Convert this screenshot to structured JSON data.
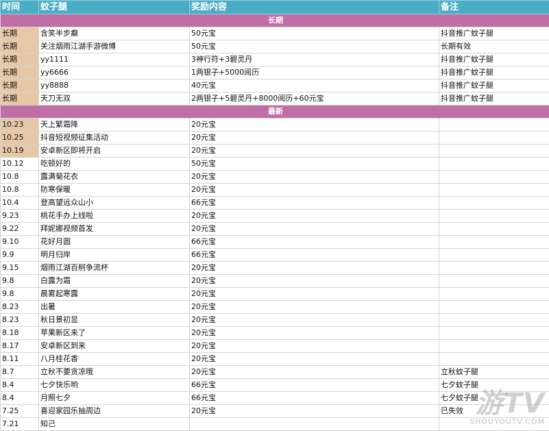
{
  "headers": [
    "时间",
    "蚊子腿",
    "奖励内容",
    "备注"
  ],
  "sections": [
    {
      "title": "长期",
      "rows": [
        {
          "time": "长期",
          "name": "含笑半步癫",
          "reward": "50元宝",
          "note": "抖音推广蚊子腿",
          "hl": true
        },
        {
          "time": "长期",
          "name": "关注烟雨江湖手游微博",
          "reward": "50元宝",
          "note": "长期有效",
          "hl": true
        },
        {
          "time": "长期",
          "name": "yy1111",
          "reward": "3神行符+3碧灵丹",
          "note": "抖音推广蚊子腿",
          "hl": true
        },
        {
          "time": "长期",
          "name": "yy6666",
          "reward": "1两银子+5000阅历",
          "note": "抖音推广蚊子腿",
          "hl": true
        },
        {
          "time": "长期",
          "name": "yy8888",
          "reward": "40元宝",
          "note": "抖音推广蚊子腿",
          "hl": true
        },
        {
          "time": "长期",
          "name": "天刀无双",
          "reward": "2两银子+5碧灵丹+8000阅历+60元宝",
          "note": "抖音推广蚊子腿",
          "hl": true
        }
      ]
    },
    {
      "title": "最新",
      "rows": [
        {
          "time": "10.23",
          "name": "天上繁霜降",
          "reward": "20元宝",
          "note": "",
          "hl": true
        },
        {
          "time": "10.25",
          "name": "抖音短视频征集活动",
          "reward": "20元宝",
          "note": "",
          "hl": true
        },
        {
          "time": "10.19",
          "name": "安卓新区即将开启",
          "reward": "20元宝",
          "note": "",
          "hl": true
        },
        {
          "time": "10.12",
          "name": "吃顿好的",
          "reward": "50元宝",
          "note": "",
          "hl": false
        },
        {
          "time": "10.8",
          "name": "露满菊花衣",
          "reward": "20元宝",
          "note": "",
          "hl": false
        },
        {
          "time": "10.8",
          "name": "防寒保暖",
          "reward": "20元宝",
          "note": "",
          "hl": false
        },
        {
          "time": "10.4",
          "name": "登高望远众山小",
          "reward": "66元宝",
          "note": "",
          "hl": false
        },
        {
          "time": "9.23",
          "name": "桃花手办上线啦",
          "reward": "20元宝",
          "note": "",
          "hl": false
        },
        {
          "time": "9.22",
          "name": "拜妮娜视频首发",
          "reward": "20元宝",
          "note": "",
          "hl": false
        },
        {
          "time": "9.10",
          "name": "花好月圆",
          "reward": "66元宝",
          "note": "",
          "hl": false
        },
        {
          "time": "9.9",
          "name": "明月归岸",
          "reward": "66元宝",
          "note": "",
          "hl": false
        },
        {
          "time": "9.15",
          "name": "烟雨江湖百舸争流杯",
          "reward": "20元宝",
          "note": "",
          "hl": false
        },
        {
          "time": "9.8",
          "name": "白露为霜",
          "reward": "20元宝",
          "note": "",
          "hl": false
        },
        {
          "time": "9.8",
          "name": "晨雾起寒露",
          "reward": "20元宝",
          "note": "",
          "hl": false
        },
        {
          "time": "8.23",
          "name": "出暑",
          "reward": "20元宝",
          "note": "",
          "hl": false
        },
        {
          "time": "8.23",
          "name": "秋日景初显",
          "reward": "20元宝",
          "note": "",
          "hl": false
        },
        {
          "time": "8.18",
          "name": "苹果新区来了",
          "reward": "20元宝",
          "note": "",
          "hl": false
        },
        {
          "time": "8.17",
          "name": "安卓新区到来",
          "reward": "20元宝",
          "note": "",
          "hl": false
        },
        {
          "time": "8.11",
          "name": "八月桂花香",
          "reward": "20元宝",
          "note": "",
          "hl": false
        },
        {
          "time": "8.7",
          "name": "立秋不要贪凉哦",
          "reward": "20元宝",
          "note": "立秋蚊子腿",
          "hl": false
        },
        {
          "time": "8.4",
          "name": "七夕快乐哟",
          "reward": "66元宝",
          "note": "七夕蚊子腿",
          "hl": false
        },
        {
          "time": "8.4",
          "name": "月照七夕",
          "reward": "66元宝",
          "note": "七夕蚊子腿",
          "hl": false
        },
        {
          "time": "7.25",
          "name": "喜迎家园乐抽周边",
          "reward": "20元宝",
          "note": "已失效",
          "hl": false
        },
        {
          "time": "7.21",
          "name": "知己",
          "reward": "",
          "note": "",
          "hl": false
        }
      ]
    }
  ],
  "watermark": {
    "logo": "游TV",
    "url": "SHOUYOUTV.COM"
  }
}
